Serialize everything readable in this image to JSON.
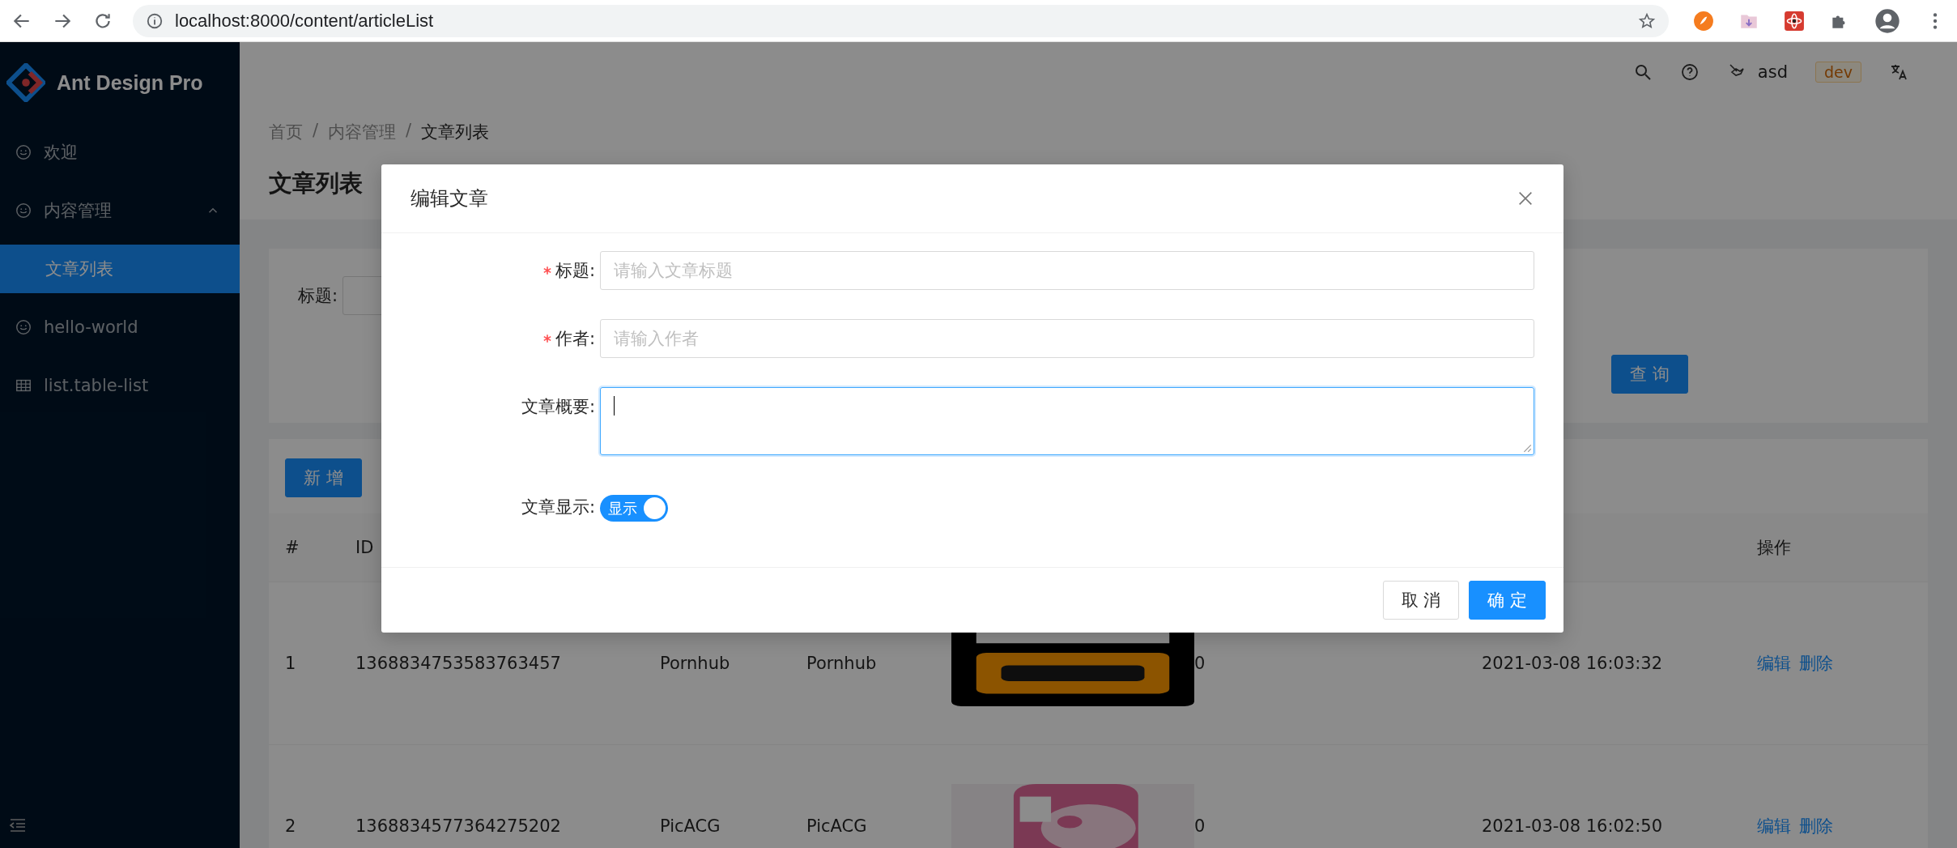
{
  "browser": {
    "url": "localhost:8000/content/articleList"
  },
  "sidebar": {
    "logo": "Ant Design Pro",
    "items": [
      {
        "label": "欢迎",
        "selected": false
      },
      {
        "label": "内容管理",
        "selected": false,
        "expanded": true,
        "children": [
          {
            "label": "文章列表",
            "selected": true
          }
        ]
      },
      {
        "label": "hello-world",
        "selected": false
      },
      {
        "label": "list.table-list",
        "selected": false
      }
    ]
  },
  "header": {
    "user": "asd",
    "env_tag": "dev"
  },
  "breadcrumb": [
    {
      "kind": "link",
      "text": "首页"
    },
    {
      "kind": "separator",
      "text": "/"
    },
    {
      "kind": "link",
      "text": "内容管理"
    },
    {
      "kind": "separator",
      "text": "/"
    },
    {
      "kind": "current",
      "text": "文章列表"
    }
  ],
  "page_title": "文章列表",
  "search_form": {
    "fields": [
      {
        "label": "标题:"
      }
    ],
    "submit": "查 询"
  },
  "toolbar": {
    "add_button": "新 增"
  },
  "table": {
    "columns": [
      {
        "label": "#"
      },
      {
        "label": "ID"
      },
      {},
      {},
      {},
      {},
      {},
      {
        "label": "操作"
      }
    ],
    "rows": [
      {
        "index": "1",
        "id": "1368834753583763457",
        "column_3": "Pornhub",
        "column_4": "Pornhub",
        "column_6": "0",
        "time": "2021-03-08 16:03:32",
        "actions": [
          "编辑",
          "删除"
        ]
      },
      {
        "index": "2",
        "id": "1368834577364275202",
        "column_3": "PicACG",
        "column_4": "PicACG",
        "column_6": "0",
        "time": "2021-03-08 16:02:50",
        "actions": [
          "编辑",
          "删除"
        ]
      }
    ]
  },
  "modal": {
    "title": "编辑文章",
    "fields": [
      {
        "kind": "input",
        "label": "标题:",
        "required": true,
        "placeholder": "请输入文章标题"
      },
      {
        "kind": "input",
        "label": "作者:",
        "required": true,
        "placeholder": "请输入作者"
      },
      {
        "kind": "textarea",
        "label": "文章概要:",
        "required": false,
        "focused": true
      },
      {
        "kind": "switch",
        "label": "文章显示:",
        "required": false,
        "on": true,
        "on_text": "显示"
      }
    ],
    "buttons": [
      {
        "label": "取 消",
        "primary": false
      },
      {
        "label": "确 定",
        "primary": true
      }
    ]
  }
}
